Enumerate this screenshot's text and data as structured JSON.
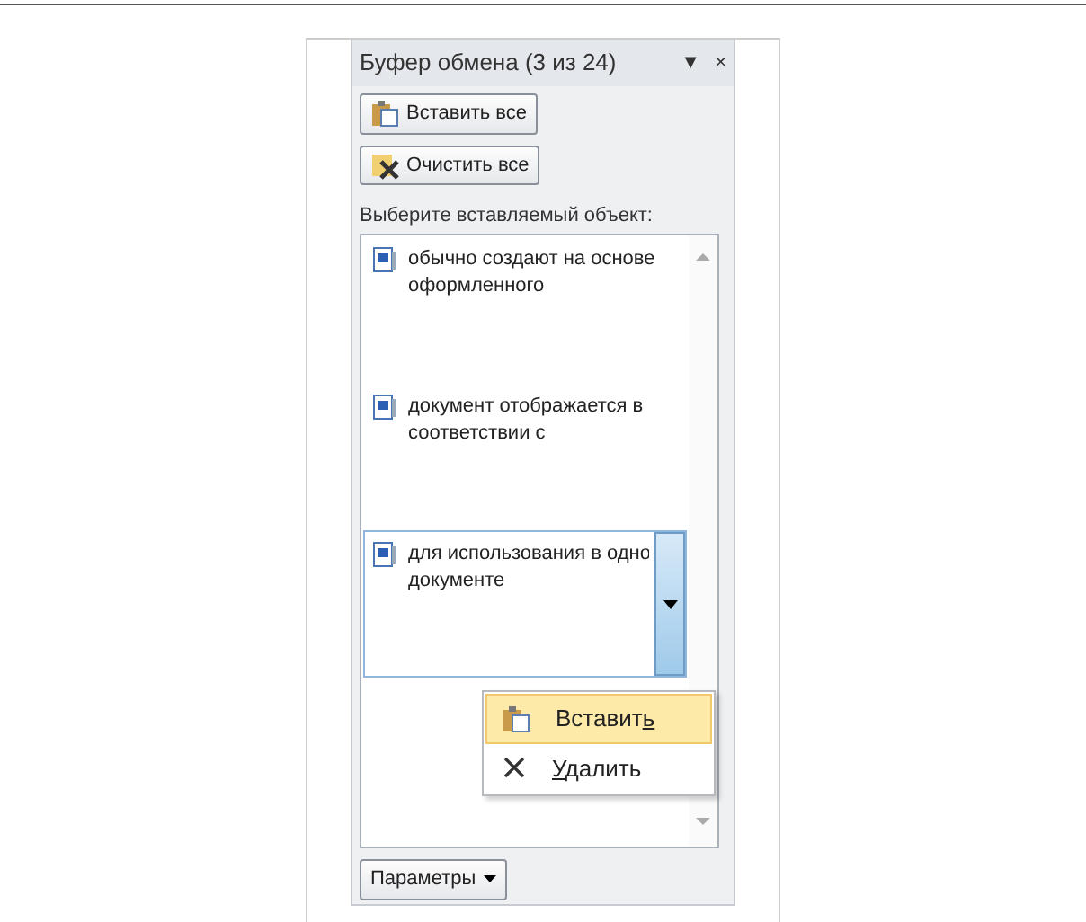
{
  "pane": {
    "title": "Буфер обмена (3 из 24)",
    "menu_glyph": "▼",
    "close_glyph": "×"
  },
  "buttons": [
    {
      "kind": "paste",
      "label": "Вставить все"
    },
    {
      "kind": "clear",
      "label": "Очистить все"
    }
  ],
  "prompt": "Выберите вставляемый объект:",
  "items": [
    {
      "lines": [
        "обычно создают на основе",
        "оформленного"
      ],
      "selected": false
    },
    {
      "lines": [
        "документ отображается в",
        "соответствии с"
      ],
      "selected": false
    },
    {
      "lines": [
        "для использования в одно",
        "документе"
      ],
      "selected": true
    }
  ],
  "context_menu": [
    {
      "kind": "paste",
      "before": "Вставит",
      "underlined": "ь",
      "selected": true
    },
    {
      "kind": "delete",
      "underlined": "У",
      "after": "далить",
      "selected": false
    }
  ],
  "options_button": {
    "label": "Параметры"
  }
}
